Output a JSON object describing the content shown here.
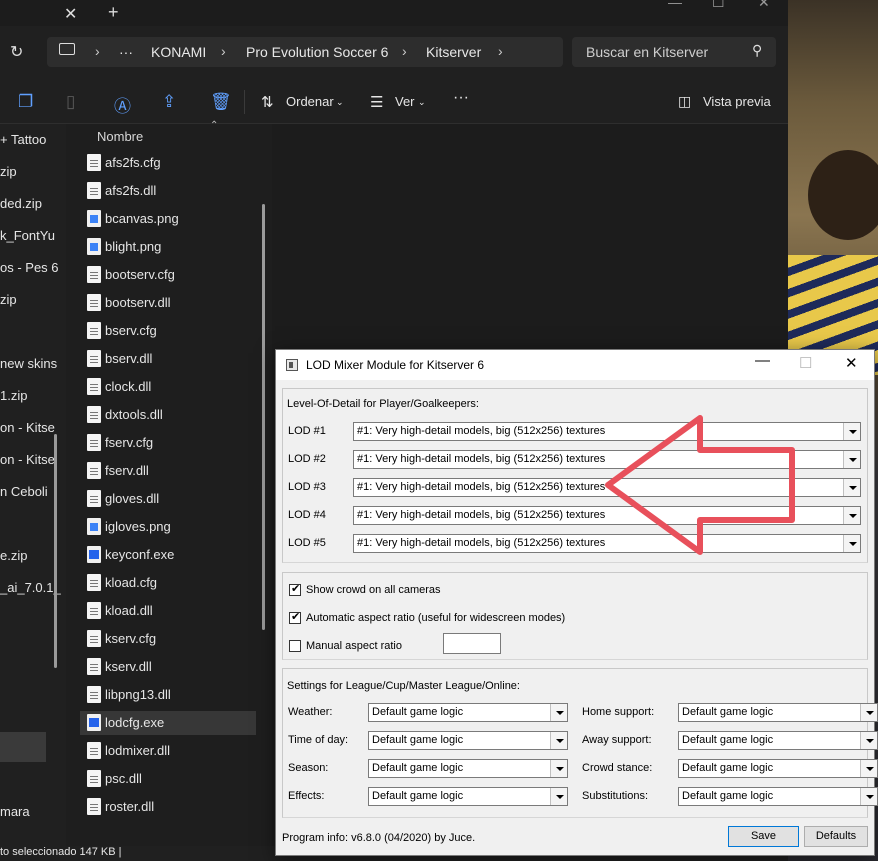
{
  "explorer": {
    "tab_close": "✕",
    "tab_new": "+",
    "breadcrumb": {
      "more": "···",
      "items": [
        "KONAMI",
        "Pro Evolution Soccer 6",
        "Kitserver"
      ]
    },
    "search_placeholder": "Buscar en Kitserver",
    "toolbar": {
      "sort_label": "Ordenar",
      "view_label": "Ver",
      "more": "···",
      "preview_label": "Vista previa"
    },
    "column_name": "Nombre",
    "nav_items": [
      "+ Tattoo",
      "zip",
      "ded.zip",
      "k_FontYu",
      "os - Pes 6",
      "zip",
      "new skins",
      "1.zip",
      "on - Kitse",
      "on - Kitse",
      "n Ceboli",
      "e.zip",
      "_ai_7.0.1_",
      "mara"
    ],
    "files": [
      {
        "name": "afs2fs.cfg",
        "icon": "cfg"
      },
      {
        "name": "afs2fs.dll",
        "icon": "cfg"
      },
      {
        "name": "bcanvas.png",
        "icon": "img"
      },
      {
        "name": "blight.png",
        "icon": "img"
      },
      {
        "name": "bootserv.cfg",
        "icon": "cfg"
      },
      {
        "name": "bootserv.dll",
        "icon": "cfg"
      },
      {
        "name": "bserv.cfg",
        "icon": "cfg"
      },
      {
        "name": "bserv.dll",
        "icon": "cfg"
      },
      {
        "name": "clock.dll",
        "icon": "cfg"
      },
      {
        "name": "dxtools.dll",
        "icon": "cfg"
      },
      {
        "name": "fserv.cfg",
        "icon": "cfg"
      },
      {
        "name": "fserv.dll",
        "icon": "cfg"
      },
      {
        "name": "gloves.dll",
        "icon": "cfg"
      },
      {
        "name": "igloves.png",
        "icon": "img"
      },
      {
        "name": "keyconf.exe",
        "icon": "exe"
      },
      {
        "name": "kload.cfg",
        "icon": "cfg"
      },
      {
        "name": "kload.dll",
        "icon": "cfg"
      },
      {
        "name": "kserv.cfg",
        "icon": "cfg"
      },
      {
        "name": "kserv.dll",
        "icon": "cfg"
      },
      {
        "name": "libpng13.dll",
        "icon": "cfg"
      },
      {
        "name": "lodcfg.exe",
        "icon": "exe",
        "selected": true
      },
      {
        "name": "lodmixer.dll",
        "icon": "cfg"
      },
      {
        "name": "psc.dll",
        "icon": "cfg"
      },
      {
        "name": "roster.dll",
        "icon": "cfg"
      }
    ],
    "status_text": "to seleccionado  147 KB  |"
  },
  "dialog": {
    "title": "LOD Mixer Module for Kitserver 6",
    "lod_group_label": "Level-Of-Detail for Player/Goalkeepers:",
    "lods": [
      {
        "label": "LOD #1",
        "value": "#1: Very high-detail models, big (512x256) textures"
      },
      {
        "label": "LOD #2",
        "value": "#1: Very high-detail models, big (512x256) textures"
      },
      {
        "label": "LOD #3",
        "value": "#1: Very high-detail models, big (512x256) textures"
      },
      {
        "label": "LOD #4",
        "value": "#1: Very high-detail models, big (512x256) textures"
      },
      {
        "label": "LOD #5",
        "value": "#1: Very high-detail models, big (512x256) textures"
      }
    ],
    "options": {
      "crowd_label": "Show crowd on all cameras",
      "crowd_checked": true,
      "aspect_auto_label": "Automatic aspect ratio (useful for widescreen modes)",
      "aspect_auto_checked": true,
      "aspect_manual_label": "Manual aspect ratio",
      "aspect_manual_checked": false,
      "aspect_manual_value": ""
    },
    "settings_group_label": "Settings for League/Cup/Master League/Online:",
    "settings_left": [
      {
        "label": "Weather:",
        "value": "Default game logic"
      },
      {
        "label": "Time of day:",
        "value": "Default game logic"
      },
      {
        "label": "Season:",
        "value": "Default game logic"
      },
      {
        "label": "Effects:",
        "value": "Default game logic"
      }
    ],
    "settings_right": [
      {
        "label": "Home support:",
        "value": "Default game logic"
      },
      {
        "label": "Away support:",
        "value": "Default game logic"
      },
      {
        "label": "Crowd stance:",
        "value": "Default game logic"
      },
      {
        "label": "Substitutions:",
        "value": "Default game logic"
      }
    ],
    "program_info": "Program info: v6.8.0 (04/2020) by Juce.",
    "save_label": "Save",
    "defaults_label": "Defaults",
    "check_mark": "✔"
  },
  "annotation": {
    "arrow_color": "#e8505b",
    "arrow_direction": "left"
  },
  "icons": {
    "refresh": "refresh-icon",
    "search": "search-icon",
    "copy": "copy-icon",
    "paste": "paste-icon",
    "rename": "rename-icon",
    "share": "share-icon",
    "delete": "delete-icon",
    "sort": "sort-icon",
    "view": "view-icon",
    "preview": "preview-pane-icon"
  }
}
